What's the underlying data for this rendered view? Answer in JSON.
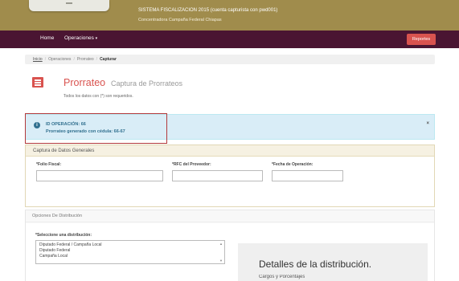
{
  "header": {
    "system_title": "SISTEMA FISCALIZACION 2015 (cuenta capturista con pwd001)",
    "subtitle": "Concentradora Campaña Federal Chiapas"
  },
  "nav": {
    "home": "Home",
    "operaciones": "Operaciones",
    "caret": "▾",
    "reportes": "Reportes"
  },
  "breadcrumb": {
    "items": [
      "Inicio",
      "Operaciones",
      "Prorrateo",
      "Capturar"
    ],
    "separator": "/"
  },
  "page": {
    "title": "Prorrateo",
    "subtitle": "Captura de Prorrateos",
    "required_note": "Todos los datos con (*) son requeridos."
  },
  "alert": {
    "icon_glyph": "i",
    "operation_id": "ID OPERACIÓN: 66",
    "message": "Prorrateo generado con cédula: 66-67",
    "close": "×"
  },
  "general_panel": {
    "title": "Captura de Datos Generales",
    "fields": {
      "folio": {
        "label": "*Folio Fiscal:",
        "value": ""
      },
      "rfc": {
        "label": "*RFC del Proveedor:",
        "value": ""
      },
      "fecha": {
        "label": "*Fecha de Operación:",
        "value": ""
      }
    }
  },
  "distribution_panel": {
    "title": "Opciones De Distribución",
    "select_label": "*Seleccione una distribución:",
    "options": [
      "Diputado Federal / Campaña Local",
      "Diputado Federal",
      "Campaña Local"
    ],
    "scroll_up": "▲",
    "scroll_down": "▼"
  },
  "details": {
    "title": "Detalles de la distribución.",
    "subtitle": "Cargos y Porcentajes"
  },
  "colors": {
    "header": "#a08c4c",
    "navbar": "#4a1532",
    "accent": "#d9534f",
    "info_bg": "#d9edf7",
    "info_text": "#31708f"
  }
}
